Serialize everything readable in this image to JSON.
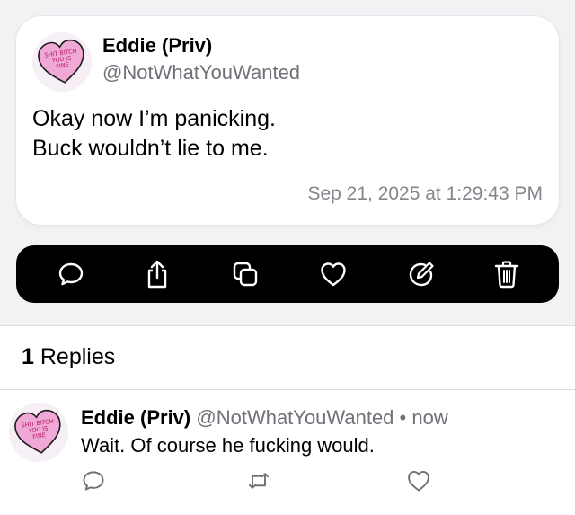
{
  "tweet": {
    "author_name": "Eddie (Priv)",
    "author_handle": "@NotWhatYouWanted",
    "body_lines": [
      "Okay now I’m panicking.",
      "Buck wouldn’t lie to me."
    ],
    "timestamp": "Sep 21, 2025 at 1:29:43 PM",
    "avatar_text": [
      "SHIT BITCH",
      "YOU IS",
      "FINE"
    ]
  },
  "actions": {
    "items": [
      {
        "name": "reply-icon"
      },
      {
        "name": "share-icon"
      },
      {
        "name": "copy-icon"
      },
      {
        "name": "like-icon"
      },
      {
        "name": "edit-icon"
      },
      {
        "name": "delete-icon"
      }
    ]
  },
  "replies": {
    "count": "1",
    "label": "Replies"
  },
  "reply": {
    "author_name": "Eddie (Priv)",
    "author_handle": "@NotWhatYouWanted",
    "separator": "•",
    "time": "now",
    "text": "Wait. Of course he fucking would.",
    "avatar_text": [
      "SHIT BITCH",
      "YOU IS",
      "FINE"
    ],
    "actions": [
      "reply-icon",
      "retweet-icon",
      "like-icon"
    ]
  },
  "colors": {
    "background": "#f2f2f4",
    "card": "#ffffff",
    "action_bar": "#000000",
    "secondary_text": "#707078",
    "heart_avatar": "#f0a9d6"
  }
}
